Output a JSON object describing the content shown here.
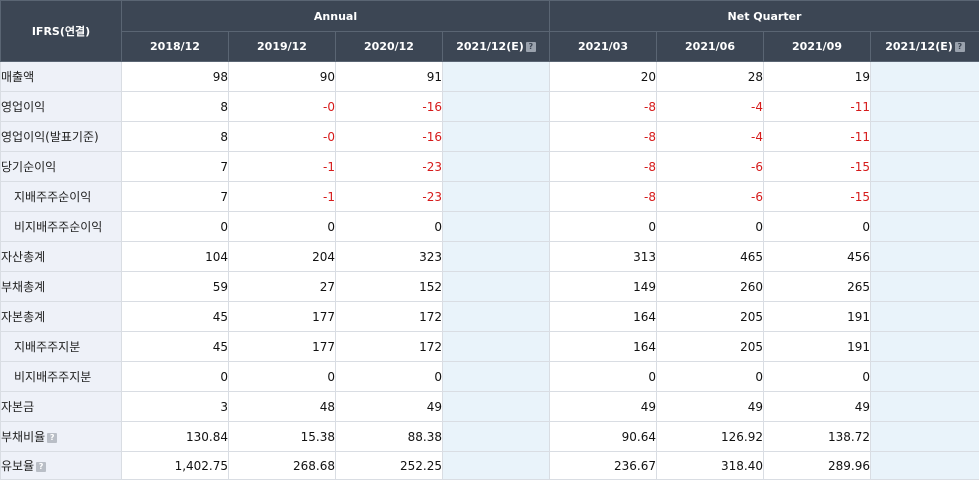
{
  "header": {
    "corner": "IFRS(연결)",
    "group_annual": "Annual",
    "group_quarter": "Net Quarter",
    "annual_cols": [
      "2018/12",
      "2019/12",
      "2020/12",
      "2021/12(E)"
    ],
    "quarter_cols": [
      "2021/03",
      "2021/06",
      "2021/09",
      "2021/12(E)"
    ]
  },
  "help_icon": "?",
  "rows": [
    {
      "label": "매출액",
      "a1": "98",
      "a2": "90",
      "a3": "91",
      "a4": "",
      "q1": "20",
      "q2": "28",
      "q3": "19",
      "q4": ""
    },
    {
      "label": "영업이익",
      "a1": "8",
      "a2": "-0",
      "a3": "-16",
      "a4": "",
      "q1": "-8",
      "q2": "-4",
      "q3": "-11",
      "q4": ""
    },
    {
      "label": "영업이익(발표기준)",
      "a1": "8",
      "a2": "-0",
      "a3": "-16",
      "a4": "",
      "q1": "-8",
      "q2": "-4",
      "q3": "-11",
      "q4": ""
    },
    {
      "label": "당기순이익",
      "a1": "7",
      "a2": "-1",
      "a3": "-23",
      "a4": "",
      "q1": "-8",
      "q2": "-6",
      "q3": "-15",
      "q4": ""
    },
    {
      "label": "지배주주순이익",
      "a1": "7",
      "a2": "-1",
      "a3": "-23",
      "a4": "",
      "q1": "-8",
      "q2": "-6",
      "q3": "-15",
      "q4": ""
    },
    {
      "label": "비지배주주순이익",
      "a1": "0",
      "a2": "0",
      "a3": "0",
      "a4": "",
      "q1": "0",
      "q2": "0",
      "q3": "0",
      "q4": ""
    },
    {
      "label": "자산총계",
      "a1": "104",
      "a2": "204",
      "a3": "323",
      "a4": "",
      "q1": "313",
      "q2": "465",
      "q3": "456",
      "q4": ""
    },
    {
      "label": "부채총계",
      "a1": "59",
      "a2": "27",
      "a3": "152",
      "a4": "",
      "q1": "149",
      "q2": "260",
      "q3": "265",
      "q4": ""
    },
    {
      "label": "자본총계",
      "a1": "45",
      "a2": "177",
      "a3": "172",
      "a4": "",
      "q1": "164",
      "q2": "205",
      "q3": "191",
      "q4": ""
    },
    {
      "label": "지배주주지분",
      "a1": "45",
      "a2": "177",
      "a3": "172",
      "a4": "",
      "q1": "164",
      "q2": "205",
      "q3": "191",
      "q4": ""
    },
    {
      "label": "비지배주주지분",
      "a1": "0",
      "a2": "0",
      "a3": "0",
      "a4": "",
      "q1": "0",
      "q2": "0",
      "q3": "0",
      "q4": ""
    },
    {
      "label": "자본금",
      "a1": "3",
      "a2": "48",
      "a3": "49",
      "a4": "",
      "q1": "49",
      "q2": "49",
      "q3": "49",
      "q4": ""
    },
    {
      "label": "부채비율",
      "a1": "130.84",
      "a2": "15.38",
      "a3": "88.38",
      "a4": "",
      "q1": "90.64",
      "q2": "126.92",
      "q3": "138.72",
      "q4": ""
    },
    {
      "label": "유보율",
      "a1": "1,402.75",
      "a2": "268.68",
      "a3": "252.25",
      "a4": "",
      "q1": "236.67",
      "q2": "318.40",
      "q3": "289.96",
      "q4": ""
    }
  ],
  "colors": {
    "header_bg": "#3c4654",
    "label_bg": "#eef1f8",
    "estimate_bg": "#e9f3fa",
    "negative": "#d61b1b"
  }
}
